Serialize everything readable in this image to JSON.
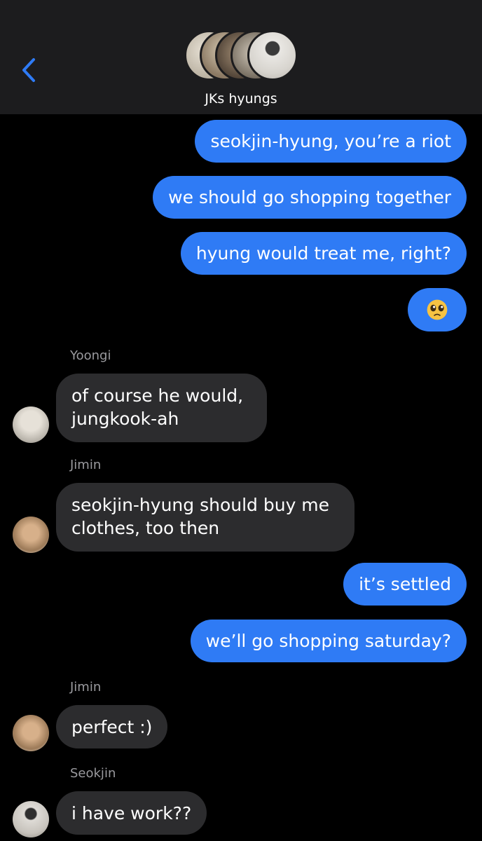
{
  "header": {
    "group_name": "JKs hyungs",
    "back_icon": "chevron-left-icon"
  },
  "colors": {
    "accent": "#2f7bf5",
    "incoming_bubble": "#2c2c2e",
    "header_bg": "#1c1c1e",
    "sender_label": "#9a9a9e"
  },
  "messages": [
    {
      "direction": "outgoing",
      "text": "seokjin-hyung, you’re a riot"
    },
    {
      "direction": "outgoing",
      "text": "we should go shopping together"
    },
    {
      "direction": "outgoing",
      "text": "hyung would treat me, right?"
    },
    {
      "direction": "outgoing",
      "text": "",
      "emoji": "pleading-face-emoji"
    },
    {
      "direction": "incoming",
      "sender": "Yoongi",
      "text_lines": [
        "of course he would,",
        "jungkook-ah"
      ]
    },
    {
      "direction": "incoming",
      "sender": "Jimin",
      "text_lines": [
        "seokjin-hyung should buy me",
        "clothes, too then"
      ]
    },
    {
      "direction": "outgoing",
      "text": "it’s settled"
    },
    {
      "direction": "outgoing",
      "text": "we’ll go shopping saturday?"
    },
    {
      "direction": "incoming",
      "sender": "Jimin",
      "text": "perfect :)"
    },
    {
      "direction": "incoming",
      "sender": "Seokjin",
      "text": "i have work??"
    }
  ]
}
